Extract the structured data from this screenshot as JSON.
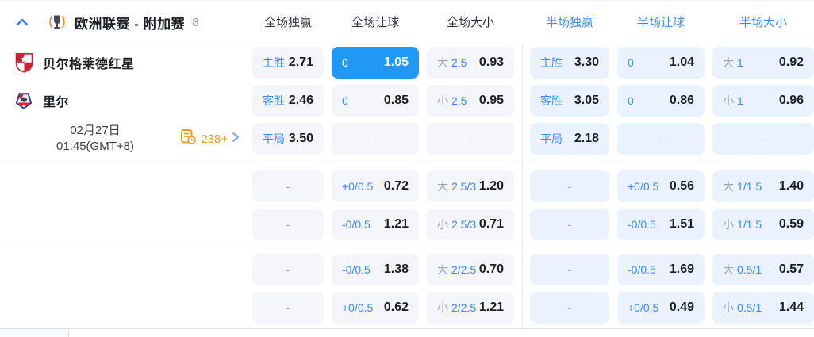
{
  "header": {
    "league_title": "欧洲联赛 - 附加赛",
    "match_count": "8",
    "columns": [
      {
        "label": "全场独赢",
        "highlighted": false
      },
      {
        "label": "全场让球",
        "highlighted": false
      },
      {
        "label": "全场大小",
        "highlighted": false
      },
      {
        "label": "半场独赢",
        "highlighted": true
      },
      {
        "label": "半场让球",
        "highlighted": true
      },
      {
        "label": "半场大小",
        "highlighted": true
      }
    ]
  },
  "match": {
    "home_team": "贝尔格莱德红星",
    "away_team": "里尔",
    "date": "02月27日",
    "time": "01:45(GMT+8)",
    "more_markets": "238+"
  },
  "odds": {
    "groups": [
      {
        "rows": [
          [
            {
              "label": "主胜",
              "value": "2.71"
            },
            {
              "label": "0",
              "value": "1.05",
              "selected": true
            },
            {
              "side": "大",
              "line": "2.5",
              "value": "0.93"
            },
            {
              "label": "主胜",
              "value": "3.30"
            },
            {
              "label": "0",
              "value": "1.04"
            },
            {
              "side": "大",
              "line": "1",
              "value": "0.92"
            }
          ],
          [
            {
              "label": "客胜",
              "value": "2.46"
            },
            {
              "label": "0",
              "value": "0.85"
            },
            {
              "side": "小",
              "line": "2.5",
              "value": "0.95"
            },
            {
              "label": "客胜",
              "value": "3.05"
            },
            {
              "label": "0",
              "value": "0.86"
            },
            {
              "side": "小",
              "line": "1",
              "value": "0.96"
            }
          ],
          [
            {
              "label": "平局",
              "value": "3.50"
            },
            {
              "dash": "-"
            },
            {
              "dash": "-"
            },
            {
              "label": "平局",
              "value": "2.18"
            },
            {
              "dash": "-"
            },
            {
              "dash": "-"
            }
          ]
        ]
      },
      {
        "rows": [
          [
            {
              "dash": "-"
            },
            {
              "label": "+0/0.5",
              "value": "0.72"
            },
            {
              "side": "大",
              "line": "2.5/3",
              "value": "1.20"
            },
            {
              "dash": "-"
            },
            {
              "label": "+0/0.5",
              "value": "0.56"
            },
            {
              "side": "大",
              "line": "1/1.5",
              "value": "1.40"
            }
          ],
          [
            {
              "dash": "-"
            },
            {
              "label": "-0/0.5",
              "value": "1.21"
            },
            {
              "side": "小",
              "line": "2.5/3",
              "value": "0.71"
            },
            {
              "dash": "-"
            },
            {
              "label": "-0/0.5",
              "value": "1.51"
            },
            {
              "side": "小",
              "line": "1/1.5",
              "value": "0.59"
            }
          ]
        ]
      },
      {
        "rows": [
          [
            {
              "dash": "-"
            },
            {
              "label": "-0/0.5",
              "value": "1.38"
            },
            {
              "side": "大",
              "line": "2/2.5",
              "value": "0.70"
            },
            {
              "dash": "-"
            },
            {
              "label": "-0/0.5",
              "value": "1.69"
            },
            {
              "side": "大",
              "line": "0.5/1",
              "value": "0.57"
            }
          ],
          [
            {
              "dash": "-"
            },
            {
              "label": "+0/0.5",
              "value": "0.62"
            },
            {
              "side": "小",
              "line": "2/2.5",
              "value": "1.21"
            },
            {
              "dash": "-"
            },
            {
              "label": "+0/0.5",
              "value": "0.49"
            },
            {
              "side": "小",
              "line": "0.5/1",
              "value": "1.44"
            }
          ]
        ]
      }
    ]
  },
  "icons": {
    "collapse": "chevron-up-icon",
    "league": "europa-league-trophy-icon",
    "home_crest": "red-star-belgrade-crest",
    "away_crest": "lille-crest",
    "markets": "markets-list-clock-icon",
    "more": "chevron-right-icon"
  },
  "colors": {
    "accent_blue": "#3d8bf8",
    "selected_cell_bg": "#2198f3",
    "fulltime_cell_bg": "#f3f5f9",
    "halftime_cell_bg": "#e9f2fd",
    "odds_text": "#1b1e24",
    "muted_gray": "#9ba3b2",
    "orange": "#f59b22"
  }
}
